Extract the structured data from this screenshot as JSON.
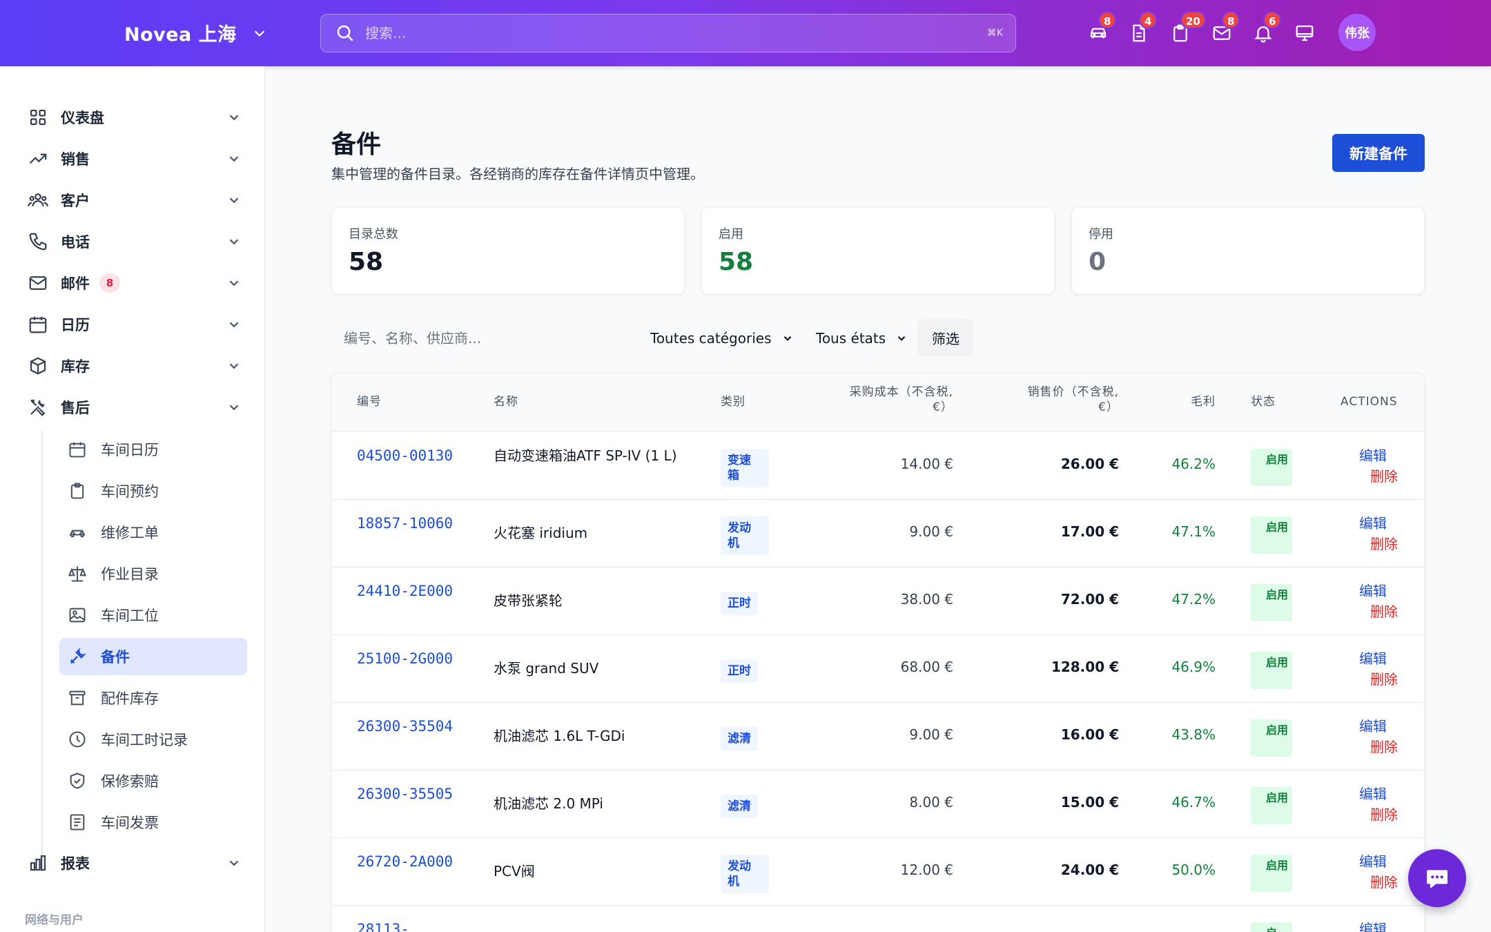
{
  "brand": {
    "name": "Novea 上海"
  },
  "search": {
    "placeholder": "搜索...",
    "shortcut": "⌘K"
  },
  "top_icons": [
    {
      "icon": "car-icon",
      "badge": "8"
    },
    {
      "icon": "document-icon",
      "badge": "4"
    },
    {
      "icon": "clipboard-icon",
      "badge": "20"
    },
    {
      "icon": "mail-icon",
      "badge": "8"
    },
    {
      "icon": "bell-icon",
      "badge": "6"
    },
    {
      "icon": "monitor-icon",
      "badge": ""
    }
  ],
  "user": {
    "initials": "伟张"
  },
  "sidebar": {
    "items": [
      {
        "label": "仪表盘",
        "icon": "grid-icon"
      },
      {
        "label": "销售",
        "icon": "trending-up-icon"
      },
      {
        "label": "客户",
        "icon": "users-icon"
      },
      {
        "label": "电话",
        "icon": "phone-icon"
      },
      {
        "label": "邮件",
        "icon": "mail-icon",
        "badge": "8"
      },
      {
        "label": "日历",
        "icon": "calendar-icon"
      },
      {
        "label": "库存",
        "icon": "box-icon"
      },
      {
        "label": "售后",
        "icon": "tools-icon"
      }
    ],
    "sub_items": [
      {
        "label": "车间日历",
        "icon": "calendar-icon"
      },
      {
        "label": "车间预约",
        "icon": "clipboard-icon"
      },
      {
        "label": "维修工单",
        "icon": "car-front-icon"
      },
      {
        "label": "作业目录",
        "icon": "scale-icon"
      },
      {
        "label": "车间工位",
        "icon": "image-icon"
      },
      {
        "label": "备件",
        "icon": "wrench-icon",
        "active": true
      },
      {
        "label": "配件库存",
        "icon": "archive-icon"
      },
      {
        "label": "车间工时记录",
        "icon": "clock-icon"
      },
      {
        "label": "保修索赔",
        "icon": "shield-check-icon"
      },
      {
        "label": "车间发票",
        "icon": "receipt-icon"
      }
    ],
    "reports": {
      "label": "报表",
      "icon": "bar-chart-icon"
    },
    "section_label": "网络与用户"
  },
  "page": {
    "title": "备件",
    "subtitle": "集中管理的备件目录。各经销商的库存在备件详情页中管理。",
    "new_button": "新建备件"
  },
  "stats": [
    {
      "label": "目录总数",
      "value": "58",
      "color": "#111827"
    },
    {
      "label": "启用",
      "value": "58",
      "color": "#15803d"
    },
    {
      "label": "停用",
      "value": "0",
      "color": "#6b7280"
    }
  ],
  "filters": {
    "search_placeholder": "编号、名称、供应商...",
    "category": "Toutes catégories",
    "state": "Tous états",
    "filter_button": "筛选"
  },
  "table": {
    "headers": {
      "code": "编号",
      "name": "名称",
      "category": "类别",
      "cost_line1": "采购成本（不含税,",
      "cost_line2": "€）",
      "price_line1": "销售价（不含税,",
      "price_line2": "€）",
      "margin": "毛利",
      "status": "状态",
      "actions": "ACTIONS"
    },
    "rows": [
      {
        "code": "04500-00130",
        "name": "自动变速箱油ATF SP-IV (1 L)",
        "category": "变速箱",
        "cost": "14.00 €",
        "price": "26.00 €",
        "margin": "46.2%",
        "status": "启用",
        "edit": "编辑",
        "delete": "删除"
      },
      {
        "code": "18857-10060",
        "name": "火花塞 iridium",
        "category": "发动机",
        "cost": "9.00 €",
        "price": "17.00 €",
        "margin": "47.1%",
        "status": "启用",
        "edit": "编辑",
        "delete": "删除"
      },
      {
        "code": "24410-2E000",
        "name": "皮带张紧轮",
        "category": "正时",
        "cost": "38.00 €",
        "price": "72.00 €",
        "margin": "47.2%",
        "status": "启用",
        "edit": "编辑",
        "delete": "删除"
      },
      {
        "code": "25100-2G000",
        "name": "水泵 grand SUV",
        "category": "正时",
        "cost": "68.00 €",
        "price": "128.00 €",
        "margin": "46.9%",
        "status": "启用",
        "edit": "编辑",
        "delete": "删除"
      },
      {
        "code": "26300-35504",
        "name": "机油滤芯 1.6L T-GDi",
        "category": "滤清",
        "cost": "9.00 €",
        "price": "16.00 €",
        "margin": "43.8%",
        "status": "启用",
        "edit": "编辑",
        "delete": "删除"
      },
      {
        "code": "26300-35505",
        "name": "机油滤芯 2.0 MPi",
        "category": "滤清",
        "cost": "8.00 €",
        "price": "15.00 €",
        "margin": "46.7%",
        "status": "启用",
        "edit": "编辑",
        "delete": "删除"
      },
      {
        "code": "26720-2A000",
        "name": "PCV阀",
        "category": "发动机",
        "cost": "12.00 €",
        "price": "24.00 €",
        "margin": "50.0%",
        "status": "启用",
        "edit": "编辑",
        "delete": "删除"
      },
      {
        "code": "28113-",
        "name": "",
        "category": "",
        "cost": "",
        "price": "",
        "margin": "",
        "status": "启",
        "edit": "编辑",
        "delete": ""
      }
    ]
  }
}
